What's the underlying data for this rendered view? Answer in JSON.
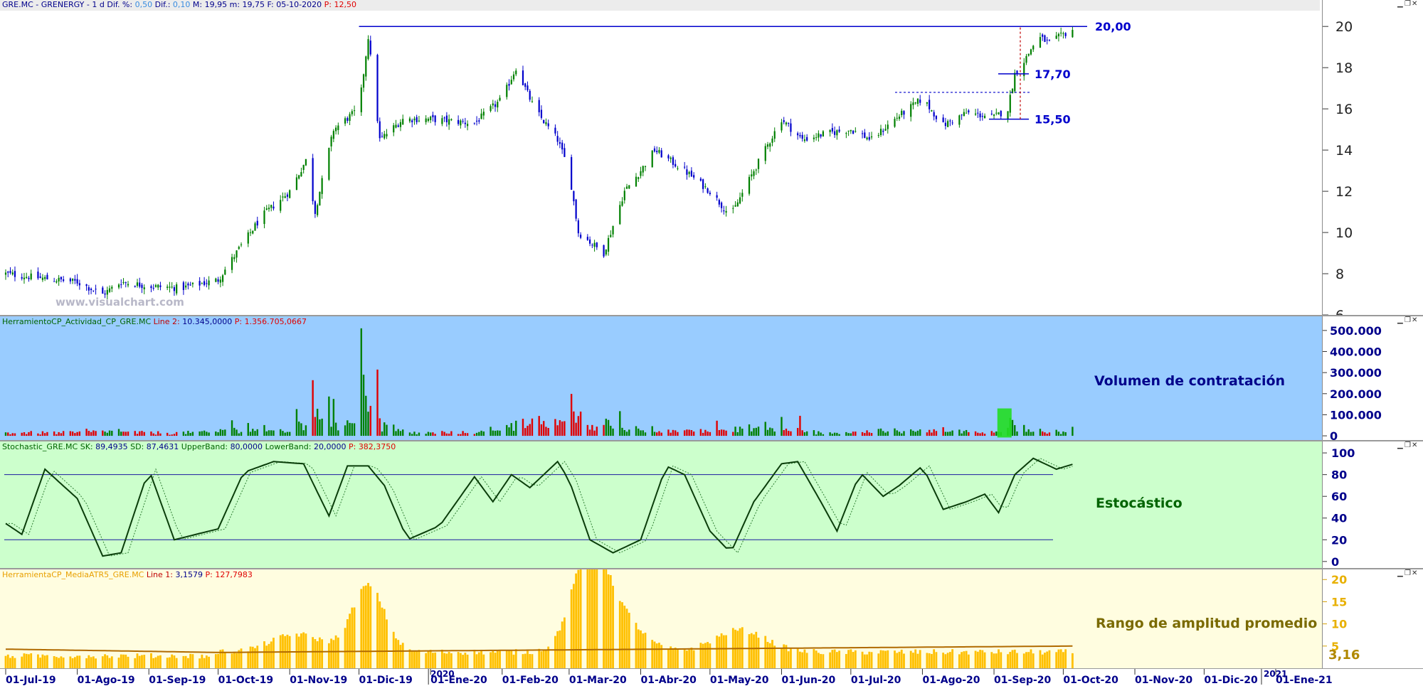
{
  "main_header": {
    "symbol": "GRE.MC - GRENERGY - ",
    "interval": "1 d",
    "dif_pct_label": " Dif. %:",
    "dif_pct": "0,50",
    "dif_label": " Dif.:",
    "dif": "0,10",
    "max_label": " M:",
    "max": "19,95",
    "min_label": " m:",
    "min": "19,75",
    "date_label": " F:",
    "date": "05-10-2020",
    "p_label": " P:",
    "p": "12,50"
  },
  "watermark": "www.visualchart.com",
  "volume_header": {
    "name": "HerramientoCP_Actividad_CP_GRE.MC",
    "line_label": " Line 2:",
    "line": "10.345,0000",
    "p_label": " P:",
    "p": "1.356.705,0667"
  },
  "stoch_header": {
    "name": "Stochastic_GRE.MC",
    "sk_label": " SK:",
    "sk": "89,4935",
    "sd_label": " SD:",
    "sd": "87,4631",
    "ub_label": " UpperBand:",
    "ub": "80,0000",
    "lb_label": " LowerBand:",
    "lb": "20,0000",
    "p_label": " P:",
    "p": "382,3750"
  },
  "atr_header": {
    "name": "HerramientaCP_MediaATR5_GRE.MC",
    "line_label": " Line 1:",
    "line": "3,1579",
    "p_label": " P:",
    "p": "127,7983"
  },
  "panel_titles": {
    "volume": "Volumen de contratación",
    "stoch": "Estocástico",
    "atr": "Rango de amplitud promedio"
  },
  "level_labels": [
    "20,00",
    "17,70",
    "15,50"
  ],
  "atr_last_value": "3,16",
  "year_labels": [
    "2020",
    "2021"
  ],
  "colors": {
    "up": "#008000",
    "down": "#0000cc",
    "vol_up": "#008000",
    "vol_down": "#e00000",
    "stoch_bg": "#ccffcc",
    "vol_bg": "#99ccff",
    "atr_bg": "#fffde0",
    "atr_bar": "#ffc000",
    "level": "#0000cc",
    "title_blue": "#00008b",
    "title_green": "#006400",
    "title_olive": "#7a6a00"
  },
  "chart_data": [
    {
      "type": "candlestick",
      "title": "GRE.MC - GRENERGY",
      "x_ticks": [
        "01-Jul-19",
        "01-Ago-19",
        "01-Sep-19",
        "01-Oct-19",
        "01-Nov-19",
        "01-Dic-19",
        "01-Ene-20",
        "01-Feb-20",
        "01-Mar-20",
        "01-Abr-20",
        "01-May-20",
        "01-Jun-20",
        "01-Jul-20",
        "01-Ago-20",
        "01-Sep-20",
        "01-Oct-20",
        "01-Nov-20",
        "01-Dic-20",
        "01-Ene-21"
      ],
      "y_ticks": [
        6,
        8,
        10,
        12,
        14,
        16,
        18,
        20
      ],
      "ylim": [
        6,
        20.8
      ],
      "horizontal_levels": [
        20.0,
        17.7,
        15.5
      ],
      "close_path": [
        [
          "01-Jul-19",
          8.0
        ],
        [
          "15-Jul-19",
          7.8
        ],
        [
          "01-Ago-19",
          7.6
        ],
        [
          "12-Ago-19",
          7.0
        ],
        [
          "20-Ago-19",
          7.6
        ],
        [
          "01-Sep-19",
          7.4
        ],
        [
          "15-Sep-19",
          7.3
        ],
        [
          "01-Oct-19",
          7.7
        ],
        [
          "10-Oct-19",
          9.2
        ],
        [
          "20-Oct-19",
          10.8
        ],
        [
          "01-Nov-19",
          12.0
        ],
        [
          "08-Nov-19",
          13.5
        ],
        [
          "12-Nov-19",
          11.0
        ],
        [
          "20-Nov-19",
          15.0
        ],
        [
          "01-Dic-19",
          16.0
        ],
        [
          "05-Dic-19",
          19.5
        ],
        [
          "10-Dic-19",
          14.5
        ],
        [
          "20-Dic-19",
          15.5
        ],
        [
          "01-Ene-20",
          15.5
        ],
        [
          "20-Ene-20",
          15.3
        ],
        [
          "01-Feb-20",
          16.5
        ],
        [
          "07-Feb-20",
          18.0
        ],
        [
          "15-Feb-20",
          16.0
        ],
        [
          "25-Feb-20",
          14.5
        ],
        [
          "01-Mar-20",
          13.0
        ],
        [
          "05-Mar-20",
          10.0
        ],
        [
          "16-Mar-20",
          9.0
        ],
        [
          "25-Mar-20",
          12.0
        ],
        [
          "01-Abr-20",
          13.0
        ],
        [
          "07-Abr-20",
          14.0
        ],
        [
          "20-Abr-20",
          13.0
        ],
        [
          "01-May-20",
          12.0
        ],
        [
          "10-May-20",
          10.8
        ],
        [
          "20-May-20",
          13.0
        ],
        [
          "01-Jun-20",
          15.5
        ],
        [
          "10-Jun-20",
          14.5
        ],
        [
          "20-Jun-20",
          14.8
        ],
        [
          "01-Jul-20",
          15.0
        ],
        [
          "10-Jul-20",
          14.5
        ],
        [
          "20-Jul-20",
          15.5
        ],
        [
          "01-Ago-20",
          16.5
        ],
        [
          "10-Ago-20",
          15.2
        ],
        [
          "20-Ago-20",
          15.8
        ],
        [
          "01-Sep-20",
          15.6
        ],
        [
          "07-Sep-20",
          16.0
        ],
        [
          "10-Sep-20",
          17.7
        ],
        [
          "15-Sep-20",
          18.5
        ],
        [
          "20-Sep-20",
          19.5
        ],
        [
          "25-Sep-20",
          19.2
        ],
        [
          "01-Oct-20",
          19.6
        ],
        [
          "05-Oct-20",
          19.85
        ]
      ]
    },
    {
      "type": "bar",
      "title": "Volumen de contratación",
      "y_ticks": [
        0,
        100000,
        200000,
        300000,
        400000,
        500000
      ],
      "y_tick_labels": [
        "0",
        "100.000",
        "200.000",
        "300.000",
        "400.000",
        "500.000"
      ],
      "ylim": [
        -20000,
        540000
      ],
      "peaks": [
        [
          "20-Nov-19",
          175000
        ],
        [
          "02-Dic-19",
          510000
        ],
        [
          "03-Dic-19",
          290000
        ],
        [
          "04-Dic-19",
          190000
        ],
        [
          "09-Feb-20",
          150000
        ],
        [
          "06-Mar-20",
          115000
        ],
        [
          "09-Jun-20",
          95000
        ],
        [
          "08-Sep-20",
          85000
        ]
      ]
    },
    {
      "type": "line",
      "title": "Estocástico",
      "y_ticks": [
        0,
        20,
        40,
        60,
        80,
        100
      ],
      "ylim": [
        -6,
        104
      ],
      "bands": [
        80,
        20
      ],
      "sk_path": [
        [
          "01-Jul-19",
          35
        ],
        [
          "08-Jul-19",
          25
        ],
        [
          "18-Jul-19",
          85
        ],
        [
          "01-Ago-19",
          58
        ],
        [
          "12-Ago-19",
          5
        ],
        [
          "20-Ago-19",
          8
        ],
        [
          "01-Sep-19",
          85
        ],
        [
          "12-Sep-19",
          20
        ],
        [
          "01-Oct-19",
          30
        ],
        [
          "12-Oct-19",
          82
        ],
        [
          "25-Oct-19",
          92
        ],
        [
          "07-Nov-19",
          90
        ],
        [
          "18-Nov-19",
          42
        ],
        [
          "26-Nov-19",
          88
        ],
        [
          "05-Dic-19",
          88
        ],
        [
          "12-Dic-19",
          70
        ],
        [
          "22-Dic-19",
          20
        ],
        [
          "05-Ene-20",
          33
        ],
        [
          "20-Ene-20",
          78
        ],
        [
          "28-Ene-20",
          55
        ],
        [
          "05-Feb-20",
          80
        ],
        [
          "13-Feb-20",
          68
        ],
        [
          "25-Feb-20",
          92
        ],
        [
          "01-Mar-20",
          75
        ],
        [
          "10-Mar-20",
          20
        ],
        [
          "20-Mar-20",
          8
        ],
        [
          "01-Abr-20",
          20
        ],
        [
          "12-Abr-20",
          88
        ],
        [
          "20-Abr-20",
          80
        ],
        [
          "01-May-20",
          28
        ],
        [
          "10-May-20",
          8
        ],
        [
          "20-May-20",
          55
        ],
        [
          "01-Jun-20",
          90
        ],
        [
          "08-Jun-20",
          92
        ],
        [
          "18-Jun-20",
          55
        ],
        [
          "25-Jun-20",
          28
        ],
        [
          "05-Jul-20",
          82
        ],
        [
          "15-Jul-20",
          60
        ],
        [
          "22-Jul-20",
          70
        ],
        [
          "01-Ago-20",
          88
        ],
        [
          "10-Ago-20",
          48
        ],
        [
          "20-Ago-20",
          55
        ],
        [
          "28-Ago-20",
          62
        ],
        [
          "03-Sep-20",
          45
        ],
        [
          "10-Sep-20",
          80
        ],
        [
          "18-Sep-20",
          95
        ],
        [
          "28-Sep-20",
          85
        ],
        [
          "05-Oct-20",
          89.4935
        ]
      ]
    },
    {
      "type": "bar",
      "title": "Rango de amplitud promedio",
      "y_ticks": [
        5,
        10,
        15,
        20
      ],
      "ylim": [
        0,
        21
      ],
      "last": 3.16,
      "peaks": [
        [
          "04-Nov-19",
          8
        ],
        [
          "05-Dic-19",
          19
        ],
        [
          "09-Mar-20",
          20
        ],
        [
          "18-Mar-20",
          15
        ],
        [
          "14-May-20",
          9
        ]
      ]
    }
  ]
}
